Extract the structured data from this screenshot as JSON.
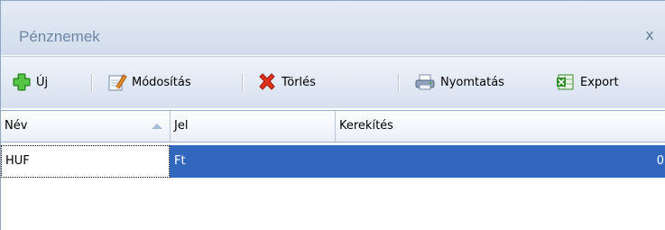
{
  "window": {
    "title": "Pénznemek",
    "close_symbol": "x"
  },
  "toolbar": {
    "new_label": "Új",
    "edit_label": "Módosítás",
    "delete_label": "Törlés",
    "print_label": "Nyomtatás",
    "export_label": "Export",
    "icons": {
      "new": "plus-icon",
      "edit": "edit-document-icon",
      "delete": "delete-x-icon",
      "print": "printer-icon",
      "export": "excel-icon"
    }
  },
  "grid": {
    "columns": [
      "Név",
      "Jel",
      "Kerekítés"
    ],
    "sort_column": "Név",
    "sort_direction": "ascending",
    "rows": [
      {
        "nev": "HUF",
        "jel": "Ft",
        "kerekites": "0",
        "selected": true
      }
    ]
  },
  "colors": {
    "selection": "#3168bd",
    "title_text": "#6e86a4",
    "delete_icon": "#e0321c",
    "new_icon": "#3aa52c"
  }
}
